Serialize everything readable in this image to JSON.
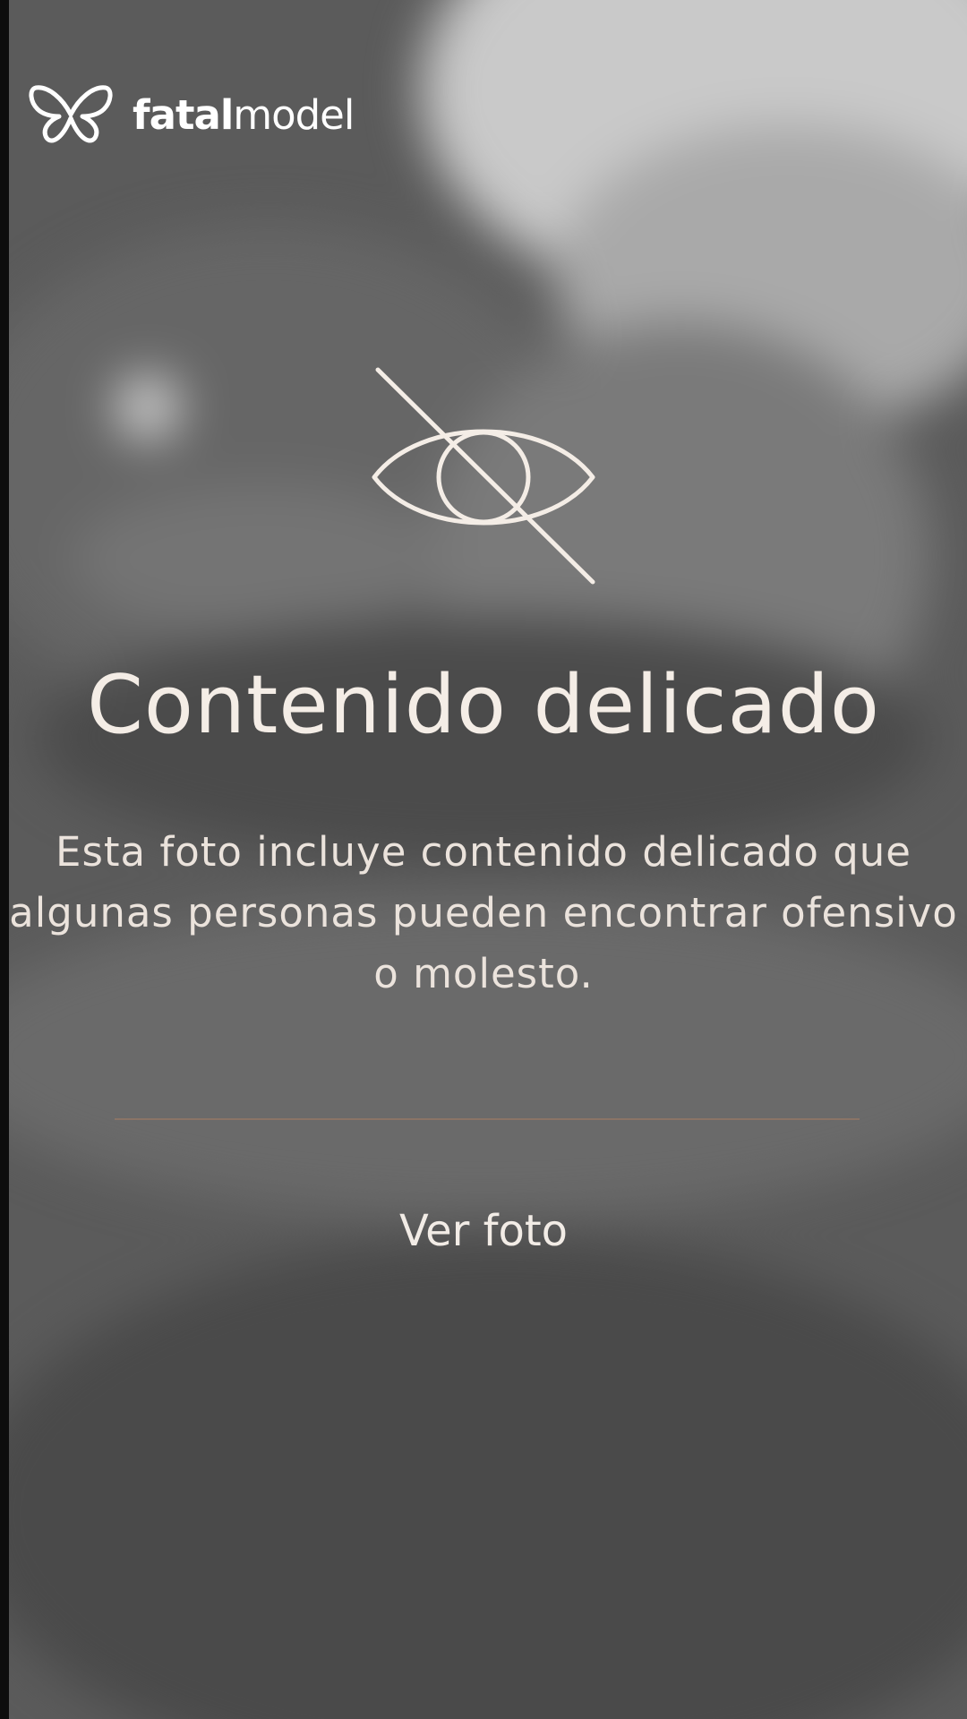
{
  "brand": {
    "logo_icon": "butterfly-icon",
    "name_bold": "fatal",
    "name_regular": "model"
  },
  "overlay": {
    "icon": "eye-slash-icon",
    "title": "Contenido delicado",
    "message": "Esta foto incluye contenido delicado que algunas personas pueden encontrar ofensivo o molesto.",
    "action_label": "Ver foto"
  },
  "colors": {
    "text": "#f4ede6",
    "divider": "#8a7466",
    "background": "#5b5b5b"
  }
}
